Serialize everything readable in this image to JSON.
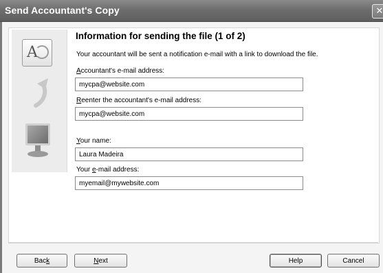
{
  "window": {
    "title": "Send Accountant's Copy",
    "close_glyph": "✕"
  },
  "illustration": {
    "doc_letter": "A",
    "icons": [
      "document-icon",
      "arrow-icon",
      "monitor-icon"
    ]
  },
  "form": {
    "heading": "Information for sending the file (1 of 2)",
    "description": "Your accountant will be sent a notification e-mail with a link to download the file.",
    "fields": [
      {
        "label_key": "A",
        "label_rest": "ccountant's e-mail address:",
        "value": "mycpa@website.com"
      },
      {
        "label_key": "R",
        "label_rest": "eenter the accountant's e-mail address:",
        "value": "mycpa@website.com"
      },
      {
        "label_key": "Y",
        "label_rest": "our name:",
        "value": "Laura Madeira"
      },
      {
        "label_pre": "Your ",
        "label_key": "e",
        "label_rest": "-mail address:",
        "value": "myemail@mywebsite.com"
      }
    ]
  },
  "buttons": {
    "back_pre": "Bac",
    "back_key": "k",
    "next_key": "N",
    "next_rest": "ext",
    "help": "Help",
    "cancel": "Cancel"
  }
}
